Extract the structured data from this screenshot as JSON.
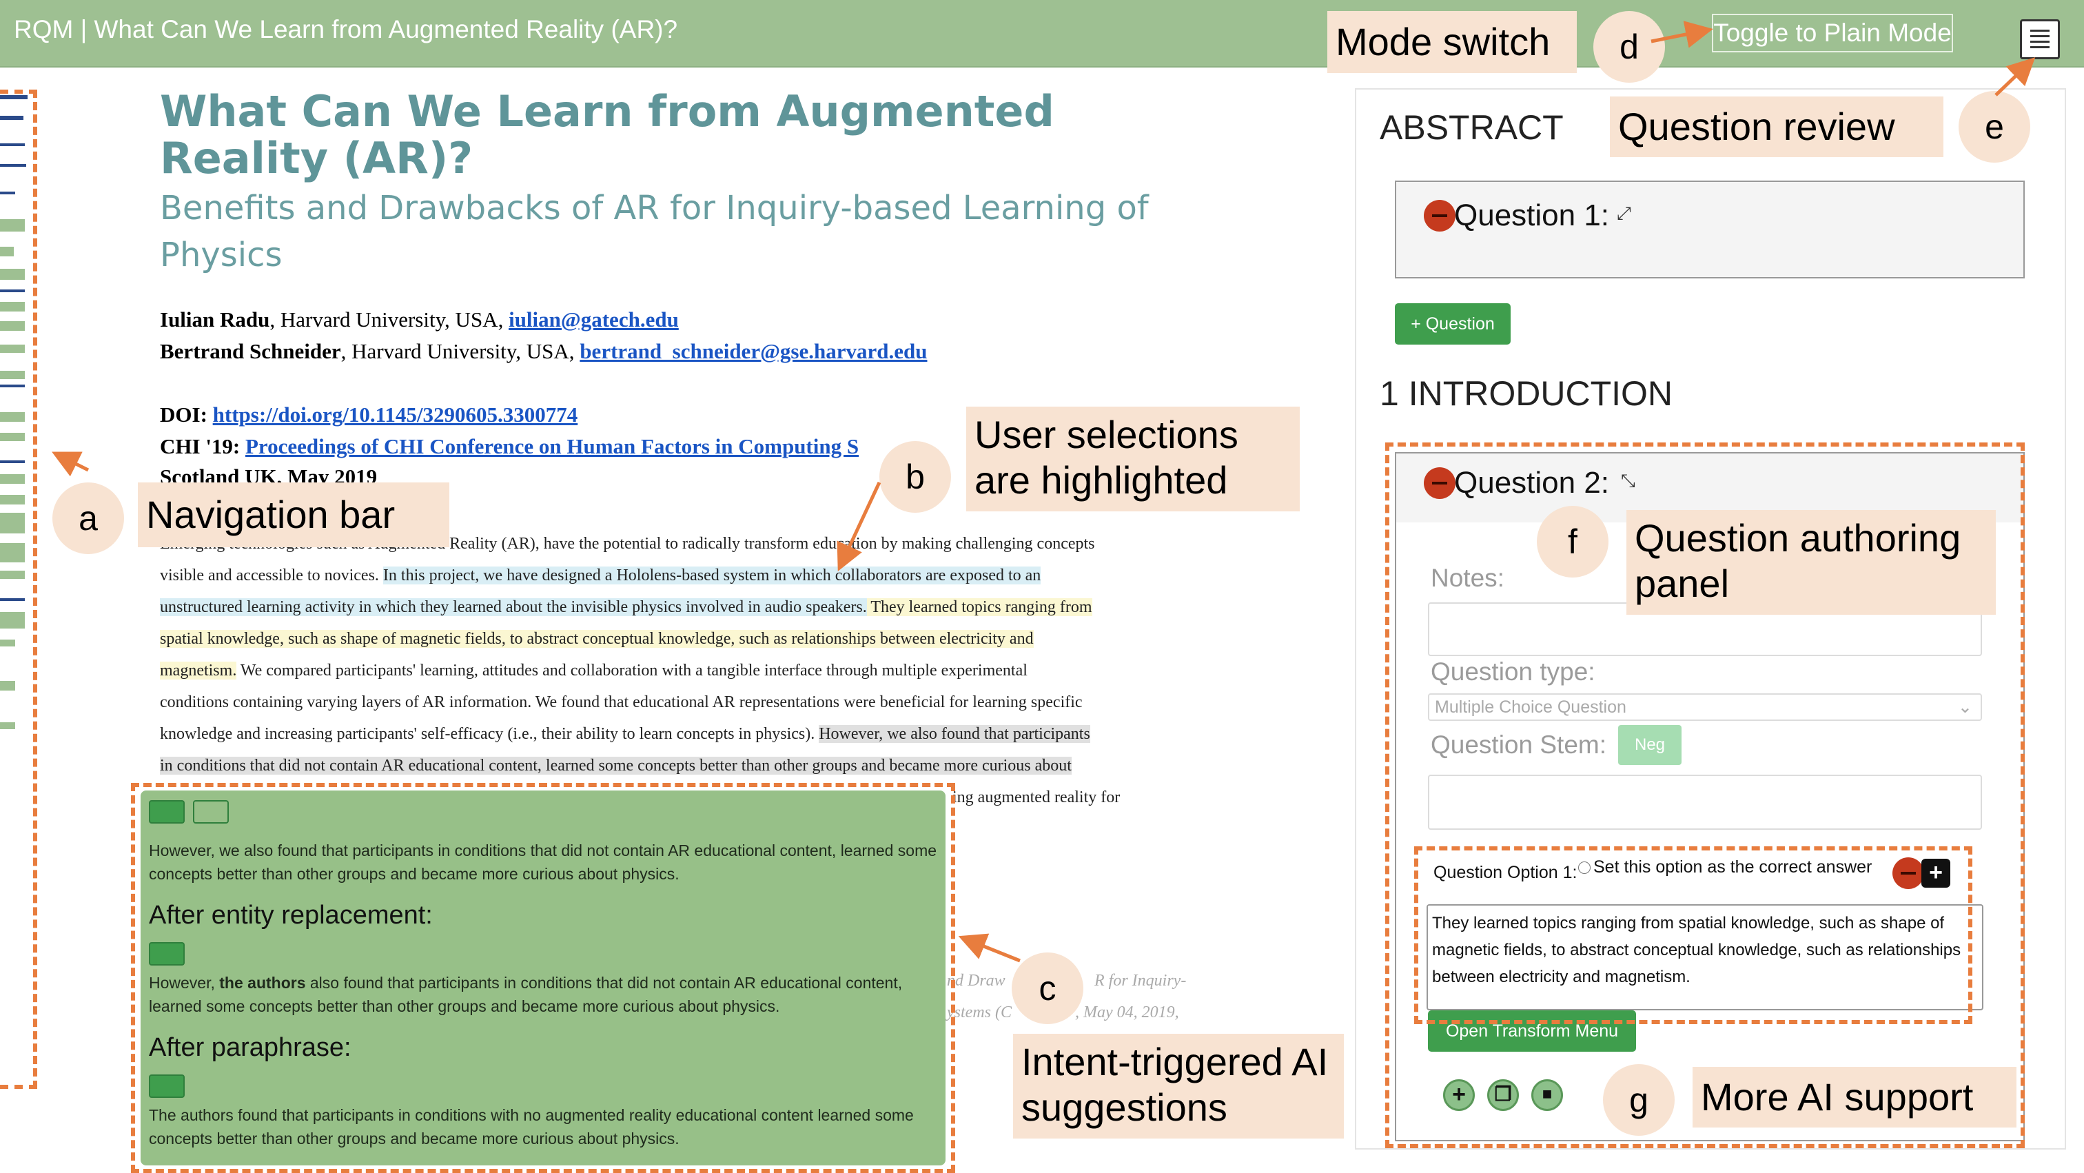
{
  "header": {
    "title": "RQM | What Can We Learn from Augmented Reality (AR)?",
    "toggle_label": "Toggle to Plain Mode"
  },
  "paper": {
    "title": "What Can We Learn from Augmented Reality (AR)?",
    "subtitle": "Benefits and Drawbacks of AR for Inquiry-based Learning of Physics",
    "authors": [
      {
        "name": "Iulian Radu",
        "affil": ", Harvard University, USA, ",
        "email": "iulian@gatech.edu"
      },
      {
        "name": "Bertrand Schneider",
        "affil": ", Harvard University, USA, ",
        "email": "bertrand_schneider@gse.harvard.edu"
      }
    ],
    "doi_label": "DOI: ",
    "doi_link": "https://doi.org/10.1145/3290605.3300774",
    "chi_label": "CHI '19: ",
    "chi_link": "Proceedings of CHI Conference on Human Factors in Computing S",
    "location": "Scotland UK, May 2019",
    "abstract_lines": [
      "Emerging technologies such as Augmented Reality (AR), have the potential to radically transform education by making challenging concepts",
      "visible and accessible to novices. ",
      "In this project, we have designed a Hololens-based system in which collaborators are exposed to an",
      "unstructured learning activity in which they learned about the invisible physics involved in audio speakers.",
      " They learned topics ranging from",
      "spatial knowledge, such as shape of magnetic fields, to abstract conceptual knowledge, such as relationships between electricity and",
      "magnetism.",
      " We compared participants' learning, attitudes and collaboration with a tangible interface through multiple experimental",
      "conditions containing varying layers of AR information. We found that educational AR representations were beneficial for learning specific",
      "knowledge and increasing participants' self-efficacy (i.e., their ability to learn concepts in physics). ",
      "However, we also found that participants",
      "in conditions that did not contain AR educational content, learned some concepts better than other groups and became more curious about",
      "ing augmented reality for"
    ],
    "citation_fragments": [
      "nd Draw",
      "R for Inquiry-",
      "ystems (C",
      ", May 04, 2019,"
    ]
  },
  "ai_panel": {
    "original_text": "However, we also found that participants in conditions that did not contain AR educational content, learned some concepts better than other groups and became more curious about physics.",
    "heading_entity": "After entity replacement:",
    "entity_prefix": "However, ",
    "entity_bold": "the authors",
    "entity_rest": " also found that participants in conditions that did not contain AR educational content, learned some concepts better than other groups and became more curious about physics.",
    "heading_paraphrase": "After paraphrase:",
    "paraphrase_text": "The authors found that participants in conditions with no augmented reality educational content learned some concepts better than other groups and became more curious about physics."
  },
  "side_panel": {
    "abstract_heading": "ABSTRACT",
    "question1_label": "Question 1:",
    "add_question_label": "+ Question",
    "intro_heading": "1 INTRODUCTION",
    "question2_label": "Question 2:",
    "notes_label": "Notes:",
    "question_type_label": "Question type:",
    "question_type_value": "Multiple Choice Question",
    "question_stem_label": "Question Stem:",
    "neg_label": "Neg",
    "option_label": "Question Option 1:",
    "correct_answer_label": "Set this option as the correct answer",
    "option_text": "They learned topics ranging from spatial knowledge, such as shape of magnetic fields, to abstract conceptual knowledge, such as relationships between electricity and magnetism.",
    "transform_button": "Open Transform Menu",
    "icons": [
      "plus-icon",
      "copy-icon",
      "save-icon"
    ]
  },
  "annotations": {
    "a": "a",
    "a_label": "Navigation bar",
    "b": "b",
    "b_label_1": "User selections",
    "b_label_2": "are highlighted",
    "c": "c",
    "c_label_1": "Intent-triggered AI",
    "c_label_2": "suggestions",
    "d": "d",
    "d_label": "Mode switch",
    "e": "e",
    "e_label": "Question review",
    "f": "f",
    "f_label_1": "Question authoring",
    "f_label_2": "panel",
    "g": "g",
    "g_label": "More AI support"
  },
  "colors": {
    "header": "#9ec092",
    "accent_orange": "#e87d3e",
    "callout_bg": "#f8e3d2",
    "title_teal": "#5f9599",
    "ai_panel": "#97c088",
    "button_green": "#3f9e4d",
    "remove_red": "#c53a1e"
  }
}
